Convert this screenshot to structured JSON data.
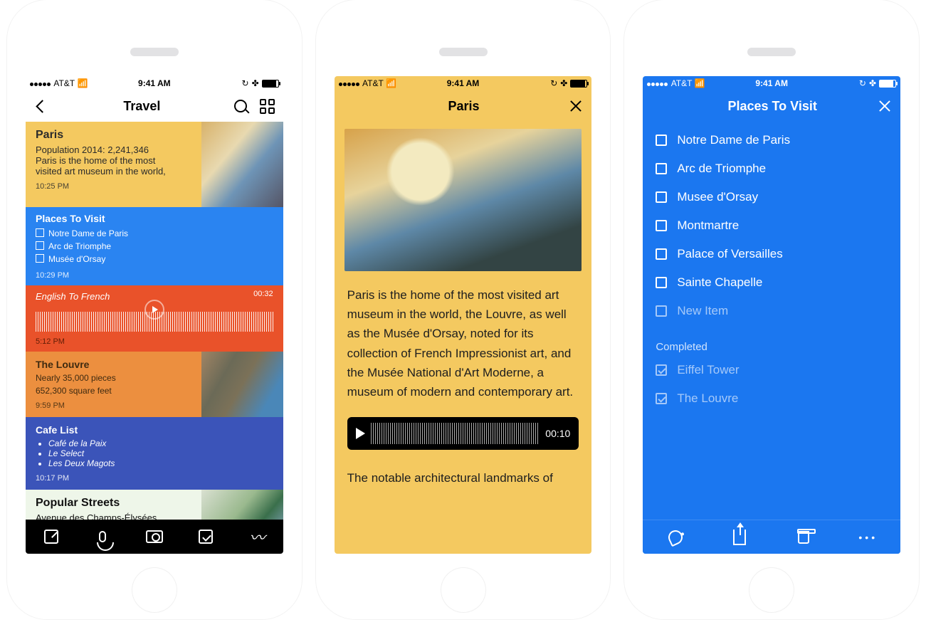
{
  "status": {
    "carrier": "AT&T",
    "time": "9:41 AM"
  },
  "p1": {
    "title": "Travel",
    "cards": {
      "paris": {
        "title": "Paris",
        "l1": "Population 2014: 2,241,346",
        "l2": "Paris is the home of the most",
        "l3": "visited art museum in the world,",
        "time": "10:25 PM"
      },
      "places": {
        "title": "Places To Visit",
        "i1": "Notre Dame de Paris",
        "i2": "Arc de Triomphe",
        "i3": "Musée d'Orsay",
        "time": "10:29 PM"
      },
      "audio": {
        "title": "English To French",
        "dur": "00:32",
        "time": "5:12 PM"
      },
      "louvre": {
        "title": "The Louvre",
        "l1": "Nearly 35,000 pieces",
        "l2": "652,300 square feet",
        "time": "9:59 PM"
      },
      "cafe": {
        "title": "Cafe List",
        "i1": "Café de la Paix",
        "i2": "Le Select",
        "i3": "Les Deux Magots",
        "time": "10:17 PM"
      },
      "streets": {
        "title": "Popular Streets",
        "l1": "Avenue des Champs-Élysées"
      }
    }
  },
  "p2": {
    "title": "Paris",
    "para1": "Paris is the home of the most visited art museum in the world, the Louvre, as well as the Musée d'Orsay, noted for its collection of French Impressionist art, and the Musée National d'Art Moderne, a museum of modern and contemporary art.",
    "audio_time": "00:10",
    "para2": "The notable architectural landmarks of"
  },
  "p3": {
    "title": "Places To Visit",
    "items": [
      "Notre Dame de Paris",
      "Arc de Triomphe",
      "Musee d'Orsay",
      "Montmartre",
      "Palace of Versailles",
      "Sainte Chapelle"
    ],
    "new": "New Item",
    "completed_label": "Completed",
    "done": [
      "Eiffel Tower",
      "The Louvre"
    ]
  }
}
